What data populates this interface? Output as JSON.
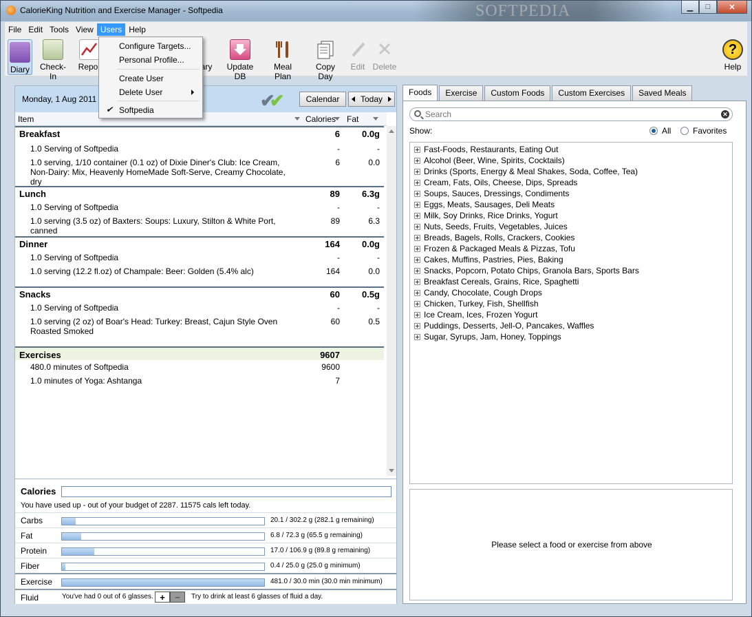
{
  "window": {
    "title": "CalorieKing Nutrition and Exercise Manager - Softpedia",
    "watermark": "SOFTPEDIA",
    "minimize": "▁",
    "maximize": "□",
    "close": "✕"
  },
  "menubar": [
    "File",
    "Edit",
    "Tools",
    "View",
    "Users",
    "Help"
  ],
  "users_menu": {
    "configure_targets": "Configure Targets...",
    "personal_profile": "Personal Profile...",
    "create_user": "Create User",
    "delete_user": "Delete User",
    "current_user": "Softpedia"
  },
  "toolbar": {
    "diary": "Diary",
    "checkin": "Check-In",
    "reports": "Repor",
    "library": "ary",
    "update_db": "Update DB",
    "meal_plan": "Meal Plan",
    "copy_day": "Copy Day",
    "edit": "Edit",
    "delete": "Delete",
    "help": "Help"
  },
  "diary": {
    "date": "Monday, 1 Aug 2011",
    "calendar_btn": "Calendar",
    "today_btn": "Today",
    "columns": {
      "item": "Item",
      "calories": "Calories",
      "fat": "Fat"
    },
    "meals": [
      {
        "name": "Breakfast",
        "calories": "6",
        "fat": "0.0g",
        "items": [
          {
            "name": "1.0 Serving of Softpedia",
            "calories": "-",
            "fat": "-"
          },
          {
            "name": "1.0 serving, 1/10 container (0.1 oz) of Dixie Diner's Club: Ice Cream, Non-Dairy: Mix, Heavenly HomeMade Soft-Serve, Creamy Chocolate, dry",
            "calories": "6",
            "fat": "0.0"
          }
        ]
      },
      {
        "name": "Lunch",
        "calories": "89",
        "fat": "6.3g",
        "items": [
          {
            "name": "1.0 Serving of Softpedia",
            "calories": "-",
            "fat": "-"
          },
          {
            "name": "1.0 serving (3.5 oz) of Baxters: Soups: Luxury, Stilton & White Port, canned",
            "calories": "89",
            "fat": "6.3"
          }
        ]
      },
      {
        "name": "Dinner",
        "calories": "164",
        "fat": "0.0g",
        "items": [
          {
            "name": "1.0 Serving of Softpedia",
            "calories": "-",
            "fat": "-"
          },
          {
            "name": "1.0 serving (12.2 fl.oz) of Champale: Beer: Golden (5.4% alc)",
            "calories": "164",
            "fat": "0.0"
          }
        ]
      },
      {
        "name": "Snacks",
        "calories": "60",
        "fat": "0.5g",
        "items": [
          {
            "name": "1.0 Serving of Softpedia",
            "calories": "-",
            "fat": "-"
          },
          {
            "name": "1.0 serving (2 oz) of Boar's Head: Turkey: Breast, Cajun Style Oven Roasted Smoked",
            "calories": "60",
            "fat": "0.5"
          }
        ]
      }
    ],
    "exercises": {
      "name": "Exercises",
      "calories": "9607",
      "items": [
        {
          "name": "480.0 minutes of Softpedia",
          "calories": "9600"
        },
        {
          "name": "1.0 minutes of Yoga: Ashtanga",
          "calories": "7"
        }
      ]
    }
  },
  "summary": {
    "calories_label": "Calories",
    "calories_note": "You have used up - out of your budget of 2287. 11575 cals left today.",
    "nutrients": [
      {
        "label": "Carbs",
        "text": "20.1 / 302.2 g (282.1 g remaining)",
        "fraction": 0.067
      },
      {
        "label": "Fat",
        "text": "6.8 / 72.3 g (65.5 g remaining)",
        "fraction": 0.094
      },
      {
        "label": "Protein",
        "text": "17.0 / 106.9 g (89.8 g remaining)",
        "fraction": 0.159
      },
      {
        "label": "Fiber",
        "text": "0.4 / 25.0 g (25.0 g minimum)",
        "fraction": 0.016
      },
      {
        "label": "Exercise",
        "text": "481.0 / 30.0 min (30.0 min minimum)",
        "fraction": 1.0
      }
    ],
    "fluid": {
      "label": "Fluid",
      "text": "You've had  0 out of 6 glasses.",
      "plus": "+",
      "minus": "−",
      "tip": "Try to drink at least 6 glasses of fluid a day."
    }
  },
  "right": {
    "tabs": [
      "Foods",
      "Exercise",
      "Custom Foods",
      "Custom Exercises",
      "Saved Meals"
    ],
    "search_placeholder": "Search",
    "show_label": "Show:",
    "radio_all": "All",
    "radio_favorites": "Favorites",
    "categories": [
      "Fast-Foods, Restaurants, Eating Out",
      "Alcohol (Beer, Wine, Spirits, Cocktails)",
      "Drinks (Sports, Energy & Meal Shakes, Soda, Coffee, Tea)",
      "Cream, Fats, Oils, Cheese, Dips, Spreads",
      "Soups, Sauces, Dressings, Condiments",
      "Eggs, Meats, Sausages, Deli Meats",
      "Milk, Soy Drinks, Rice Drinks, Yogurt",
      "Nuts, Seeds, Fruits, Vegetables, Juices",
      "Breads, Bagels, Rolls, Crackers, Cookies",
      "Frozen & Packaged Meals & Pizzas, Tofu",
      "Cakes, Muffins, Pastries, Pies, Baking",
      "Snacks, Popcorn, Potato Chips, Granola Bars, Sports Bars",
      "Breakfast Cereals, Grains, Rice, Spaghetti",
      "Candy, Chocolate, Cough Drops",
      "Chicken, Turkey, Fish, Shellfish",
      "Ice Cream, Ices, Frozen Yogurt",
      "Puddings, Desserts, Jell-O, Pancakes, Waffles",
      "Sugar, Syrups, Jam, Honey, Toppings"
    ],
    "detail_message": "Please select a food or exercise from above"
  }
}
